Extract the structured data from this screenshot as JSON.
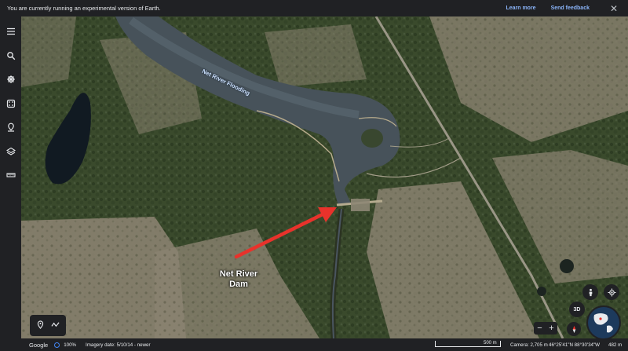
{
  "banner": {
    "message": "You are currently running an experimental version of Earth.",
    "learn_more": "Learn more",
    "send_feedback": "Send feedback",
    "close_icon": "close-icon"
  },
  "sidebar": {
    "items": [
      {
        "icon": "menu-icon"
      },
      {
        "icon": "search-icon"
      },
      {
        "icon": "voyager-icon"
      },
      {
        "icon": "dice-icon"
      },
      {
        "icon": "projects-icon"
      },
      {
        "icon": "layers-icon"
      },
      {
        "icon": "ruler-icon"
      }
    ]
  },
  "map": {
    "flood_label": "Net River Flooding",
    "dam_label_line1": "Net River",
    "dam_label_line2": "Dam",
    "annotation_color": "#e8322b"
  },
  "controls": {
    "btn_3d": "3D",
    "zoom_out": "−",
    "zoom_in": "+"
  },
  "status": {
    "logo": "Google",
    "percent": "100%",
    "imagery_date": "Imagery date: 5/10/14 - newer",
    "scale": "500 m",
    "camera": "Camera: 2,705 m",
    "coords": "46°25'41\"N 88°30'34\"W",
    "elevation": "482 m"
  }
}
